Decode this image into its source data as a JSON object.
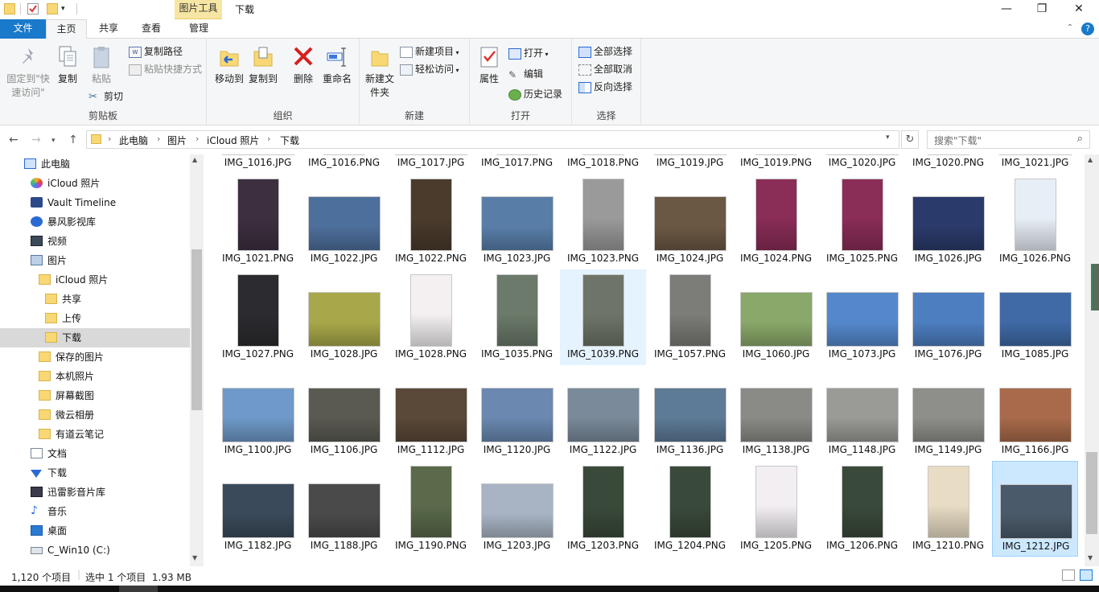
{
  "window": {
    "title": "下载",
    "context_tab": "图片工具",
    "controls": [
      "—",
      "❐",
      "✕"
    ]
  },
  "tabs": [
    "文件",
    "主页",
    "共享",
    "查看",
    "管理"
  ],
  "ribbon": {
    "clipboard": {
      "label": "剪贴板",
      "pin": "固定到\"快速访问\"",
      "copy": "复制",
      "paste": "粘贴",
      "copy_path": "复制路径",
      "paste_shortcut": "粘贴快捷方式",
      "cut": "剪切"
    },
    "organize": {
      "label": "组织",
      "move_to": "移动到",
      "copy_to": "复制到",
      "delete": "删除",
      "rename": "重命名"
    },
    "new": {
      "label": "新建",
      "new_folder": "新建文件夹",
      "new_item": "新建项目",
      "easy_access": "轻松访问"
    },
    "open": {
      "label": "打开",
      "properties": "属性",
      "open": "打开",
      "edit": "编辑",
      "history": "历史记录"
    },
    "select": {
      "label": "选择",
      "select_all": "全部选择",
      "select_none": "全部取消",
      "invert": "反向选择"
    }
  },
  "address": {
    "crumbs": [
      "此电脑",
      "图片",
      "iCloud 照片",
      "下载"
    ],
    "search_placeholder": "搜索\"下载\""
  },
  "nav_pane": [
    {
      "label": "此电脑",
      "icon": "pc-icon"
    },
    {
      "label": "iCloud 照片",
      "icon": "icloud-photos-icon"
    },
    {
      "label": "Vault Timeline",
      "icon": "vault-icon"
    },
    {
      "label": "暴风影视库",
      "icon": "video-library-icon"
    },
    {
      "label": "视频",
      "icon": "videos-icon"
    },
    {
      "label": "图片",
      "icon": "pictures-icon"
    },
    {
      "label": "iCloud 照片",
      "icon": "folder-icon"
    },
    {
      "label": "共享",
      "icon": "folder-icon"
    },
    {
      "label": "上传",
      "icon": "folder-icon"
    },
    {
      "label": "下载",
      "icon": "folder-icon"
    },
    {
      "label": "保存的图片",
      "icon": "folder-icon"
    },
    {
      "label": "本机照片",
      "icon": "folder-icon"
    },
    {
      "label": "屏幕截图",
      "icon": "folder-icon"
    },
    {
      "label": "微云相册",
      "icon": "folder-icon"
    },
    {
      "label": "有道云笔记",
      "icon": "folder-icon"
    },
    {
      "label": "文档",
      "icon": "documents-icon"
    },
    {
      "label": "下载",
      "icon": "download-icon"
    },
    {
      "label": "迅雷影音片库",
      "icon": "xunlei-icon"
    },
    {
      "label": "音乐",
      "icon": "music-icon"
    },
    {
      "label": "桌面",
      "icon": "desktop-icon"
    },
    {
      "label": "C_Win10 (C:)",
      "icon": "drive-icon"
    }
  ],
  "files": [
    {
      "name": "IMG_1016.JPG",
      "color": "#5b8fd4"
    },
    {
      "name": "IMG_1016.PNG",
      "color": "#3a3a3a"
    },
    {
      "name": "IMG_1017.JPG",
      "color": "#6f9be0"
    },
    {
      "name": "IMG_1017.PNG",
      "color": "#3b4a3a"
    },
    {
      "name": "IMG_1018.PNG",
      "color": "#3e5a3c"
    },
    {
      "name": "IMG_1019.JPG",
      "color": "#2f3a2f"
    },
    {
      "name": "IMG_1019.PNG",
      "color": "#8a8a8a"
    },
    {
      "name": "IMG_1020.JPG",
      "color": "#355f9a"
    },
    {
      "name": "IMG_1020.PNG",
      "color": "#7a7a7a"
    },
    {
      "name": "IMG_1021.JPG",
      "color": "#4e7cc2"
    },
    {
      "name": "IMG_1021.PNG",
      "color": "#3d2f40"
    },
    {
      "name": "IMG_1022.JPG",
      "color": "#4d6f9c"
    },
    {
      "name": "IMG_1022.PNG",
      "color": "#4a3b2c"
    },
    {
      "name": "IMG_1023.JPG",
      "color": "#587ea8"
    },
    {
      "name": "IMG_1023.PNG",
      "color": "#9a9a9a"
    },
    {
      "name": "IMG_1024.JPG",
      "color": "#6b5844"
    },
    {
      "name": "IMG_1024.PNG",
      "color": "#8a2d57"
    },
    {
      "name": "IMG_1025.PNG",
      "color": "#8a2d57"
    },
    {
      "name": "IMG_1026.JPG",
      "color": "#2a3a6a"
    },
    {
      "name": "IMG_1026.PNG",
      "color": "#e8eef6"
    },
    {
      "name": "IMG_1027.PNG",
      "color": "#2c2c30"
    },
    {
      "name": "IMG_1028.JPG",
      "color": "#a8a84a"
    },
    {
      "name": "IMG_1028.PNG",
      "color": "#f4f0f2"
    },
    {
      "name": "IMG_1035.PNG",
      "color": "#6b7a6a"
    },
    {
      "name": "IMG_1039.PNG",
      "color": "#6e7568"
    },
    {
      "name": "IMG_1057.PNG",
      "color": "#7c7c78"
    },
    {
      "name": "IMG_1060.JPG",
      "color": "#8aa86a"
    },
    {
      "name": "IMG_1073.JPG",
      "color": "#5488cc"
    },
    {
      "name": "IMG_1076.JPG",
      "color": "#4d7ec0"
    },
    {
      "name": "IMG_1085.JPG",
      "color": "#3f6aa6"
    },
    {
      "name": "IMG_1100.JPG",
      "color": "#6f99c8"
    },
    {
      "name": "IMG_1106.JPG",
      "color": "#5a5a52"
    },
    {
      "name": "IMG_1112.JPG",
      "color": "#5a4838"
    },
    {
      "name": "IMG_1120.JPG",
      "color": "#6a88b0"
    },
    {
      "name": "IMG_1122.JPG",
      "color": "#7a8a9a"
    },
    {
      "name": "IMG_1136.JPG",
      "color": "#5d7a96"
    },
    {
      "name": "IMG_1138.JPG",
      "color": "#8a8a86"
    },
    {
      "name": "IMG_1148.JPG",
      "color": "#9a9a96"
    },
    {
      "name": "IMG_1149.JPG",
      "color": "#8e8e8a"
    },
    {
      "name": "IMG_1166.JPG",
      "color": "#a86a4a"
    },
    {
      "name": "IMG_1182.JPG",
      "color": "#3a4a5a"
    },
    {
      "name": "IMG_1188.JPG",
      "color": "#4a4a4a"
    },
    {
      "name": "IMG_1190.PNG",
      "color": "#5a6a4a"
    },
    {
      "name": "IMG_1203.JPG",
      "color": "#a8b4c4"
    },
    {
      "name": "IMG_1203.PNG",
      "color": "#3a4a3a"
    },
    {
      "name": "IMG_1204.PNG",
      "color": "#3a4a3a"
    },
    {
      "name": "IMG_1205.PNG",
      "color": "#f2eef2"
    },
    {
      "name": "IMG_1206.PNG",
      "color": "#3a4a3a"
    },
    {
      "name": "IMG_1210.PNG",
      "color": "#e8dcc4"
    },
    {
      "name": "IMG_1212.JPG",
      "color": "#4a5a6a"
    }
  ],
  "selected_file": "IMG_1212.JPG",
  "hover_file": "IMG_1039.PNG",
  "status": {
    "count": "1,120 个项目",
    "selected": "选中 1 个项目  1.93 MB"
  },
  "colors": {
    "accent": "#1979ca",
    "selection": "#cce8ff",
    "context_tab": "#f7e6a3",
    "folder": "#f8d775"
  }
}
